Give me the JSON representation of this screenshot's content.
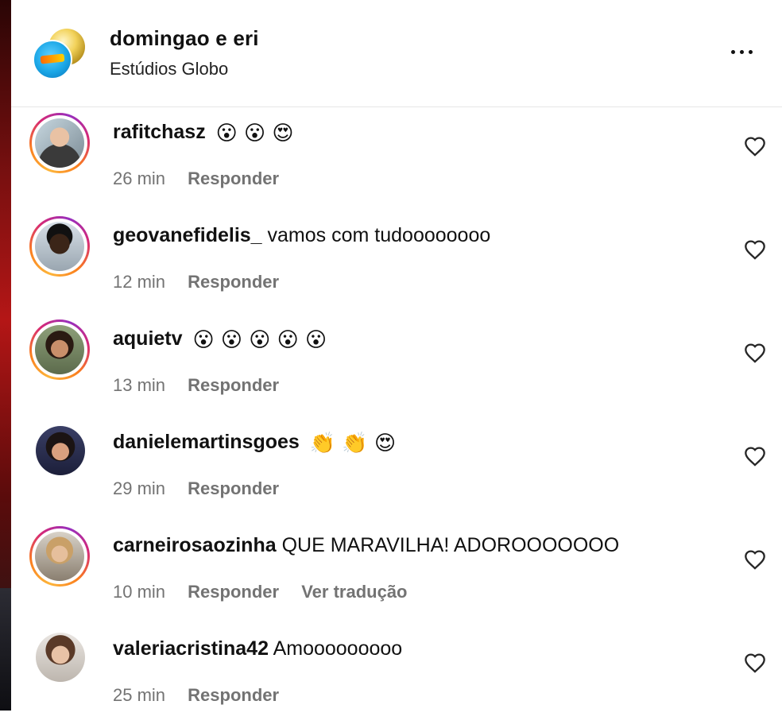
{
  "post": {
    "owner_name": "domingao e eri",
    "owner_subtitle": "Estúdios Globo",
    "more_icon": "more-horizontal-icon"
  },
  "comments": [
    {
      "username": "rafitchasz",
      "text": "",
      "emoji": "😮 😮 😍",
      "time": "26 min",
      "reply_label": "Responder",
      "story_ring": true
    },
    {
      "username": "geovanefidelis_",
      "text": "vamos com tudoooooooo",
      "emoji": "",
      "time": "12 min",
      "reply_label": "Responder",
      "story_ring": true
    },
    {
      "username": "aquietv",
      "text": "",
      "emoji": "😮 😮 😮 😮 😮",
      "time": "13 min",
      "reply_label": "Responder",
      "story_ring": true
    },
    {
      "username": "danielemartinsgoes",
      "text": "",
      "emoji": "👏 👏 😍",
      "time": "29 min",
      "reply_label": "Responder",
      "story_ring": false
    },
    {
      "username": "carneirosaozinha",
      "text": "QUE MARAVILHA! ADOROOOOOOO",
      "emoji": "",
      "time": "10 min",
      "reply_label": "Responder",
      "translate_label": "Ver tradução",
      "story_ring": true
    },
    {
      "username": "valeriacristina42",
      "text": "Amooooooooo",
      "emoji": "",
      "time": "25 min",
      "reply_label": "Responder",
      "story_ring": false
    }
  ],
  "icons": {
    "like": "heart-icon"
  },
  "colors": {
    "meta_text": "#737373",
    "story_ring": "#d62976"
  }
}
